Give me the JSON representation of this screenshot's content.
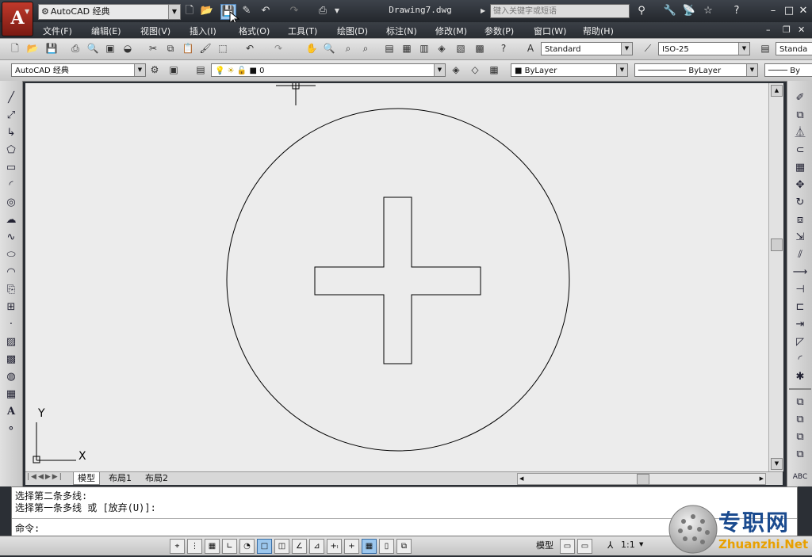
{
  "app": {
    "logo_letter": "A",
    "window_title": "Drawing7.dwg",
    "workspace": "AutoCAD 经典",
    "search_placeholder": "键入关键字或短语"
  },
  "menu": [
    "文件(F)",
    "编辑(E)",
    "视图(V)",
    "插入(I)",
    "格式(O)",
    "工具(T)",
    "绘图(D)",
    "标注(N)",
    "修改(M)",
    "参数(P)",
    "窗口(W)",
    "帮助(H)"
  ],
  "styles": {
    "text_style": "Standard",
    "dim_style": "ISO-25",
    "table_style": "Standa"
  },
  "layers": {
    "workspace": "AutoCAD 经典",
    "current_layer": "0",
    "color": "ByLayer",
    "linetype": "ByLayer",
    "lineweight": "By"
  },
  "ucs": {
    "x_label": "X",
    "y_label": "Y"
  },
  "layout_tabs": [
    "模型",
    "布局1",
    "布局2"
  ],
  "command": {
    "line1": "选择第二条多线:",
    "line2": "选择第一条多线 或 [放弃(U)]:",
    "prompt": "命令:"
  },
  "status": {
    "model_label": "模型",
    "scale": "1:1"
  },
  "watermark": {
    "brand": "专职网",
    "domain": "Zhuanzhi.Net"
  },
  "colors": {
    "title_bar": "#2b2f35",
    "canvas": "#ececec",
    "accent_red": "#c0392b",
    "watermark_blue": "#1b4b8f"
  }
}
